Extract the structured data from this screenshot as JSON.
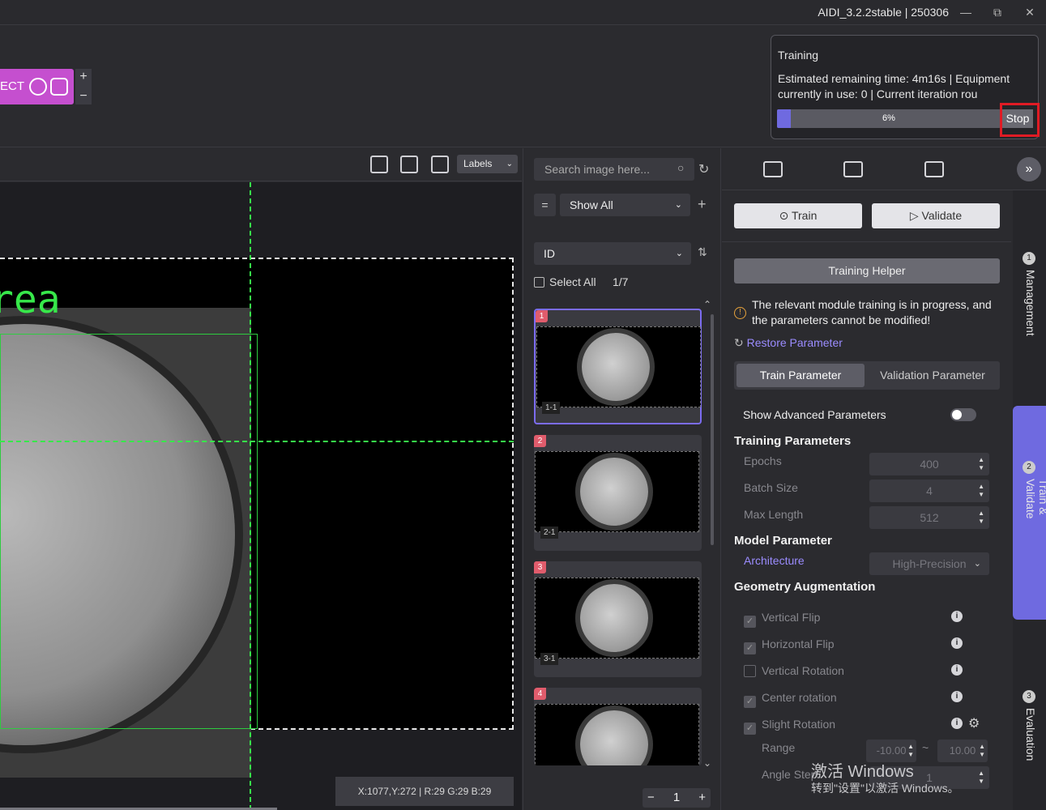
{
  "window": {
    "title": "AIDI_3.2.2stable | 250306",
    "min": "—",
    "restore": "⧉",
    "close": "✕"
  },
  "module": {
    "label": "ECT",
    "plus": "+",
    "minus": "−"
  },
  "training": {
    "title": "Training",
    "info": "Estimated remaining time: 4m16s | Equipment currently in use: 0 | Current iteration rou",
    "progress_percent": 6,
    "progress_label": "6%",
    "stop_label": "Stop"
  },
  "viewer": {
    "labels_select": "Labels",
    "area_text": "rea",
    "coord_readout": "X:1077,Y:272 | R:29 G:29 B:29"
  },
  "image_list": {
    "search_placeholder": "Search image here...",
    "filter_eq": "=",
    "filter_value": "Show All",
    "sort_value": "ID",
    "select_all": "Select All",
    "count": "1/7",
    "items": [
      {
        "badge": "1",
        "sub": "1-1"
      },
      {
        "badge": "2",
        "sub": "2-1"
      },
      {
        "badge": "3",
        "sub": "3-1"
      },
      {
        "badge": "4",
        "sub": ""
      }
    ],
    "page": "1"
  },
  "params": {
    "train_btn": "Train",
    "validate_btn": "Validate",
    "helper_btn": "Training Helper",
    "warning": "The relevant module training is in progress, and the parameters cannot be modified!",
    "restore": "Restore Parameter",
    "tab_train": "Train Parameter",
    "tab_validation": "Validation Parameter",
    "advanced_label": "Show Advanced Parameters",
    "training_section": "Training Parameters",
    "epochs_label": "Epochs",
    "epochs_value": "400",
    "batch_label": "Batch Size",
    "batch_value": "4",
    "maxlen_label": "Max Length",
    "maxlen_value": "512",
    "model_section": "Model Parameter",
    "arch_label": "Architecture",
    "arch_value": "High-Precision",
    "geo_section": "Geometry Augmentation",
    "aug_items": [
      {
        "label": "Vertical Flip",
        "checked": true
      },
      {
        "label": "Horizontal Flip",
        "checked": true
      },
      {
        "label": "Vertical Rotation",
        "checked": false
      },
      {
        "label": "Center rotation",
        "checked": true
      },
      {
        "label": "Slight Rotation",
        "checked": true
      }
    ],
    "range_label": "Range",
    "range_min": "-10.00",
    "range_tilde": "~",
    "range_max": "10.00",
    "angle_step_label": "Angle Step",
    "angle_step_value": "1"
  },
  "steps": [
    {
      "num": "1",
      "label": "Management"
    },
    {
      "num": "2",
      "label": "Train & Validate"
    },
    {
      "num": "3",
      "label": "Evaluation"
    }
  ],
  "watermark": {
    "line1": "激活 Windows",
    "line2": "转到\"设置\"以激活 Windows。"
  },
  "colors": {
    "accent": "#6f6ae0",
    "module": "#c54fcf",
    "annotation": "#37e84a",
    "highlight": "#e01b24"
  }
}
